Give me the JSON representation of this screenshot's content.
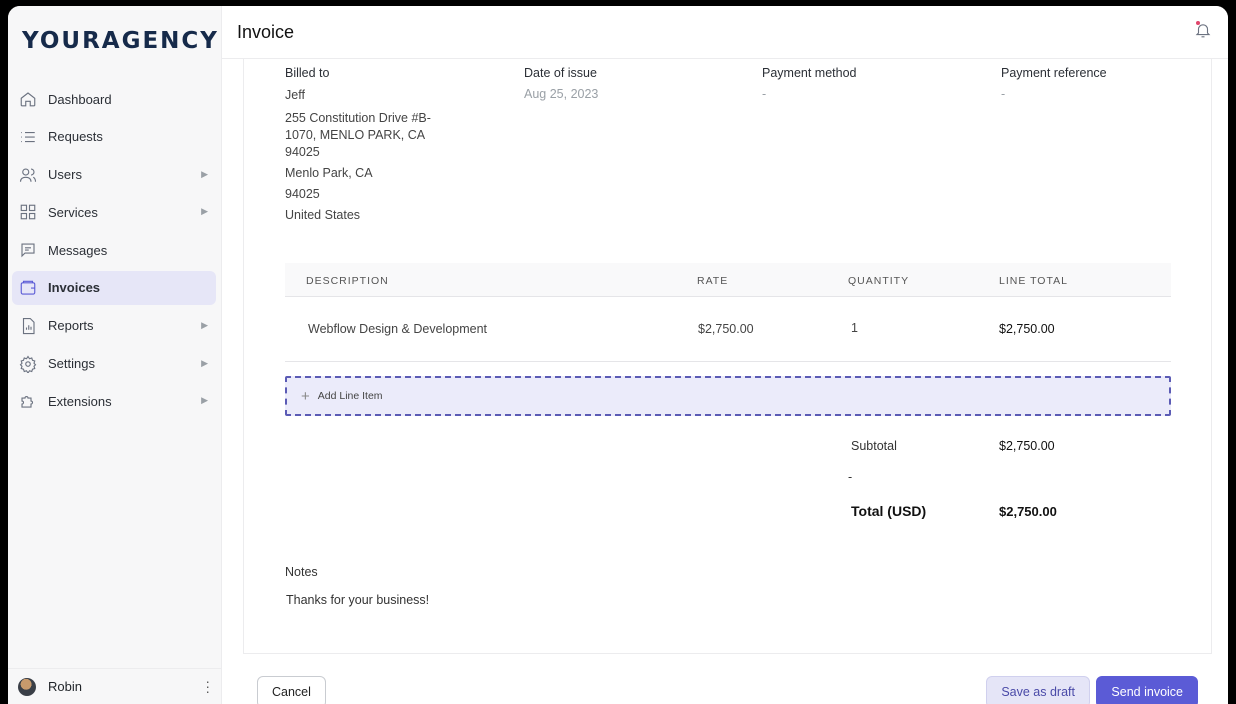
{
  "app": {
    "logo": "YOURAGENCY",
    "title": "Invoice",
    "accent_color": "#5b5bd6"
  },
  "sidebar": {
    "items": [
      {
        "label": "Dashboard",
        "icon": "home-icon",
        "chevron": false
      },
      {
        "label": "Requests",
        "icon": "list-icon",
        "chevron": false
      },
      {
        "label": "Users",
        "icon": "users-icon",
        "chevron": true
      },
      {
        "label": "Services",
        "icon": "grid-icon",
        "chevron": true
      },
      {
        "label": "Messages",
        "icon": "message-icon",
        "chevron": false
      },
      {
        "label": "Invoices",
        "icon": "wallet-icon",
        "chevron": false,
        "active": true
      },
      {
        "label": "Reports",
        "icon": "report-icon",
        "chevron": true
      },
      {
        "label": "Settings",
        "icon": "gear-icon",
        "chevron": true
      },
      {
        "label": "Extensions",
        "icon": "puzzle-icon",
        "chevron": true
      }
    ],
    "chevron_glyph": "▶",
    "user_name": "Robin"
  },
  "invoice": {
    "billed_to_label": "Billed to",
    "billed_to_name": "Jeff",
    "address_lines": [
      "255 Constitution Drive #B-1070, MENLO PARK, CA 94025",
      "Menlo Park, CA",
      "94025",
      "United States"
    ],
    "date_label": "Date of issue",
    "date_value": "Aug 25, 2023",
    "payment_method_label": "Payment method",
    "payment_method_value": "-",
    "payment_ref_label": "Payment reference",
    "payment_ref_value": "-"
  },
  "table": {
    "headers": {
      "description": "DESCRIPTION",
      "rate": "RATE",
      "quantity": "QUANTITY",
      "line_total": "LINE TOTAL"
    },
    "rows": [
      {
        "description": "Webflow Design & Development",
        "rate": "$2,750.00",
        "quantity": "1",
        "line_total": "$2,750.00"
      }
    ],
    "add_line_label": "Add Line Item",
    "add_line_glyph": "+"
  },
  "summary": {
    "subtotal_label": "Subtotal",
    "subtotal_value": "$2,750.00",
    "tax_dash": "-",
    "total_label": "Total (USD)",
    "total_value": "$2,750.00"
  },
  "notes": {
    "label": "Notes",
    "value": "Thanks for your business!"
  },
  "footer": {
    "cancel": "Cancel",
    "save_draft": "Save as draft",
    "send": "Send invoice"
  }
}
